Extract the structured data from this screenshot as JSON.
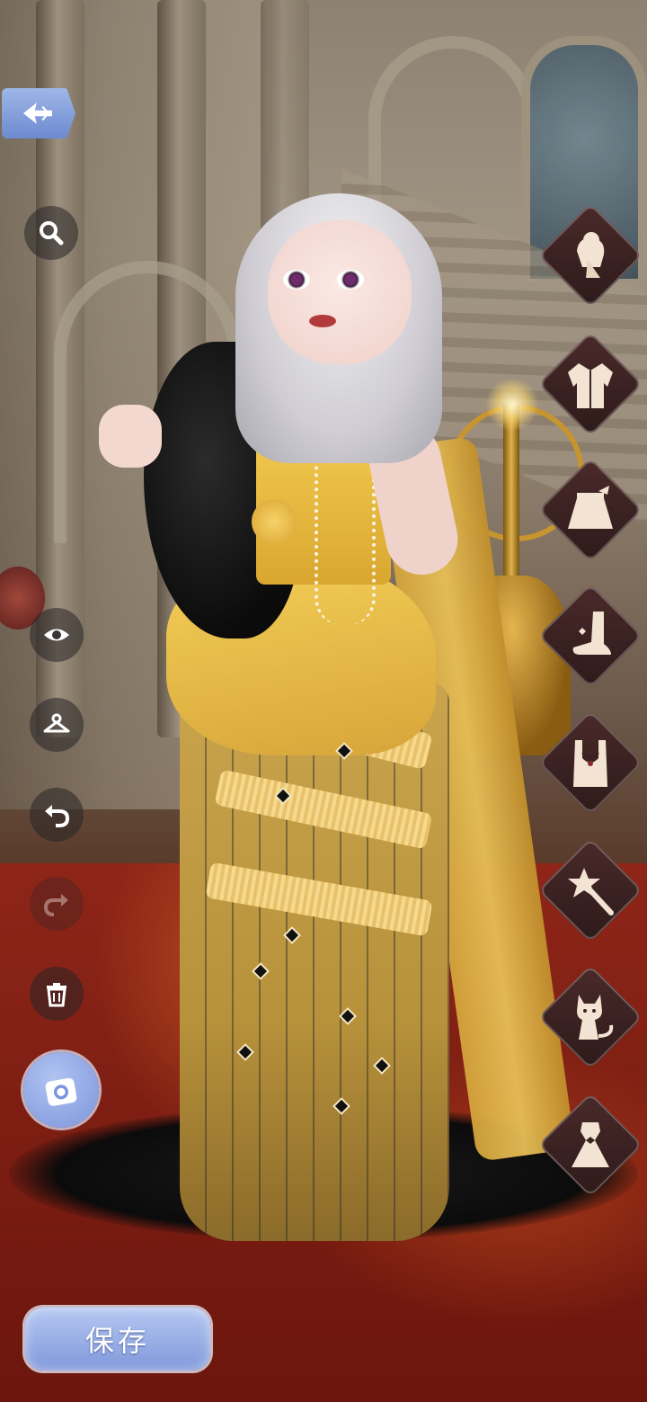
{
  "toolbar": {
    "back_icon": "back-arrow-icon",
    "search_icon": "search-icon",
    "eye_icon": "eye-icon",
    "hanger_icon": "hanger-icon",
    "undo_icon": "undo-icon",
    "redo_icon": "redo-icon",
    "redo_enabled": false,
    "delete_icon": "trash-icon",
    "camera_icon": "camera-icon"
  },
  "categories": [
    {
      "id": "hair",
      "icon": "hairstyle-icon"
    },
    {
      "id": "top",
      "icon": "jacket-icon"
    },
    {
      "id": "bottom",
      "icon": "skirt-icon"
    },
    {
      "id": "shoes",
      "icon": "shoe-icon"
    },
    {
      "id": "accessories",
      "icon": "necklace-icon"
    },
    {
      "id": "effects",
      "icon": "magic-wand-icon"
    },
    {
      "id": "pets",
      "icon": "cat-icon"
    },
    {
      "id": "dress",
      "icon": "dress-icon"
    }
  ],
  "save": {
    "label": "保存"
  },
  "colors": {
    "accent_blue": "#7f98da",
    "tab_bg": "#3a2222",
    "dress_gold": "#e0b446",
    "carpet_red": "#8e2518"
  }
}
